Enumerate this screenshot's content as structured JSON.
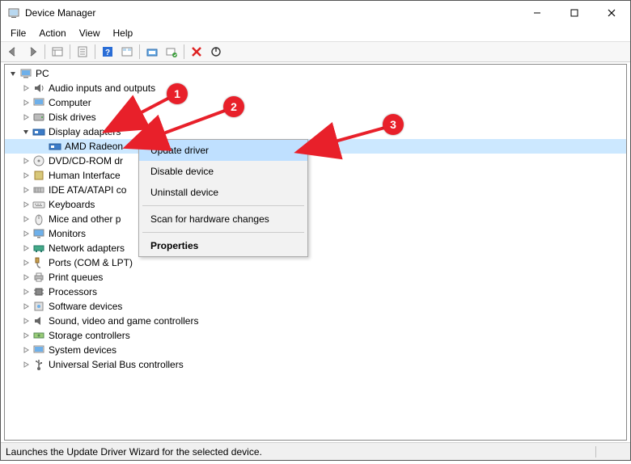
{
  "window": {
    "title": "Device Manager"
  },
  "menubar": {
    "file": "File",
    "action": "Action",
    "view": "View",
    "help": "Help"
  },
  "toolbar": {
    "back": "Back",
    "forward": "Forward",
    "show_hidden": "Show hidden devices",
    "properties": "Properties",
    "help": "Help",
    "update_driver": "Update device driver",
    "scan": "Scan for hardware changes",
    "disable": "Disable device",
    "uninstall": "Uninstall device",
    "refresh": "Refresh"
  },
  "tree": {
    "root": "PC",
    "nodes": [
      {
        "label": "Audio inputs and outputs",
        "expanded": false
      },
      {
        "label": "Computer",
        "expanded": false
      },
      {
        "label": "Disk drives",
        "expanded": false
      },
      {
        "label": "Display adapters",
        "expanded": true,
        "children": [
          {
            "label": "AMD Radeon",
            "selected": true
          }
        ]
      },
      {
        "label": "DVD/CD-ROM dr",
        "expanded": false
      },
      {
        "label": "Human Interface",
        "expanded": false
      },
      {
        "label": "IDE ATA/ATAPI co",
        "expanded": false
      },
      {
        "label": "Keyboards",
        "expanded": false
      },
      {
        "label": "Mice and other p",
        "expanded": false
      },
      {
        "label": "Monitors",
        "expanded": false
      },
      {
        "label": "Network adapters",
        "expanded": false
      },
      {
        "label": "Ports (COM & LPT)",
        "expanded": false
      },
      {
        "label": "Print queues",
        "expanded": false
      },
      {
        "label": "Processors",
        "expanded": false
      },
      {
        "label": "Software devices",
        "expanded": false
      },
      {
        "label": "Sound, video and game controllers",
        "expanded": false
      },
      {
        "label": "Storage controllers",
        "expanded": false
      },
      {
        "label": "System devices",
        "expanded": false
      },
      {
        "label": "Universal Serial Bus controllers",
        "expanded": false
      }
    ]
  },
  "context_menu": {
    "update_driver": "Update driver",
    "disable_device": "Disable device",
    "uninstall_device": "Uninstall device",
    "scan_changes": "Scan for hardware changes",
    "properties": "Properties"
  },
  "statusbar": {
    "text": "Launches the Update Driver Wizard for the selected device."
  },
  "annotations": {
    "step1": "1",
    "step2": "2",
    "step3": "3"
  }
}
